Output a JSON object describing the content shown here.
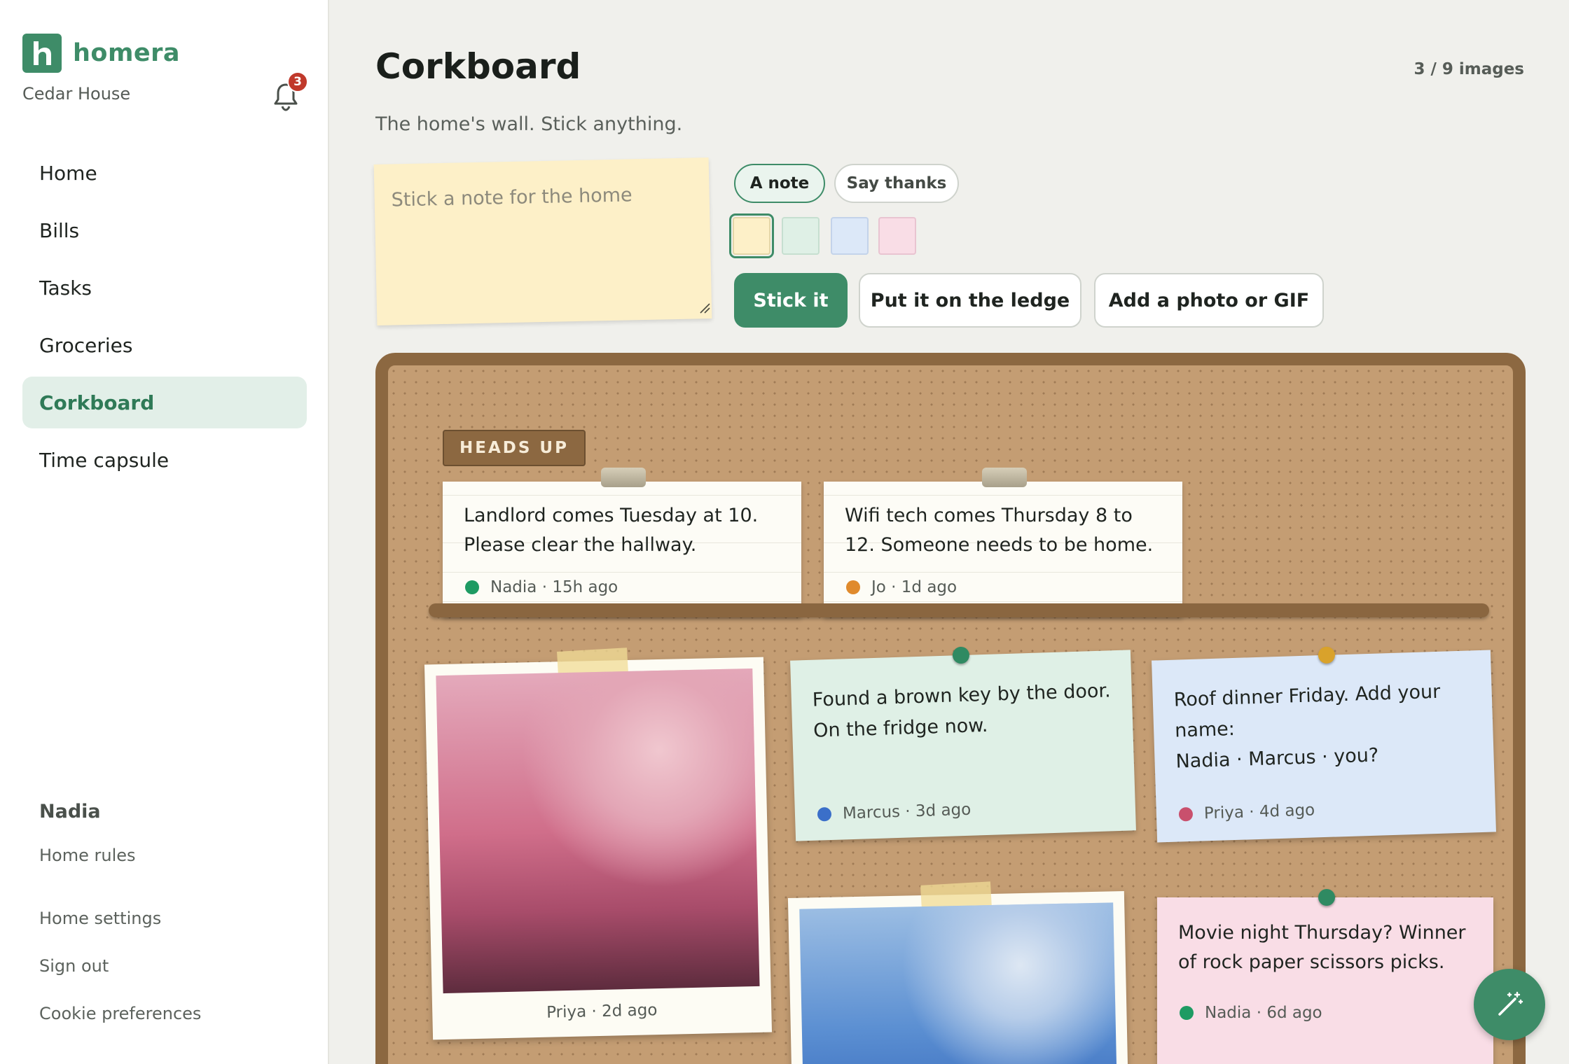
{
  "brand": {
    "name": "homera",
    "house": "Cedar House",
    "notifications": "3"
  },
  "nav": {
    "items": [
      {
        "label": "Home"
      },
      {
        "label": "Bills"
      },
      {
        "label": "Tasks"
      },
      {
        "label": "Groceries"
      },
      {
        "label": "Corkboard"
      },
      {
        "label": "Time capsule"
      }
    ],
    "active": "Corkboard"
  },
  "user": {
    "name": "Nadia",
    "links": [
      "Home rules",
      "Home settings",
      "Sign out",
      "Cookie preferences"
    ]
  },
  "page": {
    "title": "Corkboard",
    "subtitle": "The home's wall. Stick anything.",
    "image_count": "3 / 9 images"
  },
  "composer": {
    "placeholder": "Stick a note for the home",
    "kinds": [
      "A note",
      "Say thanks"
    ],
    "active_kind": "A note",
    "swatches": [
      "#fdf0c8",
      "#dff0e6",
      "#dce8f8",
      "#f9dde6"
    ],
    "selected_swatch": "#fdf0c8",
    "buttons": {
      "stick": "Stick it",
      "ledge": "Put it on the ledge",
      "media": "Add a photo or GIF"
    }
  },
  "board": {
    "headsup_label": "HEADS UP",
    "ledge": [
      {
        "text": "Landlord comes Tuesday at 10. Please clear the hallway.",
        "author": "Nadia · 15h ago",
        "dot": "#1e9b63"
      },
      {
        "text": "Wifi tech comes Thursday 8 to 12. Someone needs to be home.",
        "author": "Jo · 1d ago",
        "dot": "#e08a2c"
      }
    ],
    "notes": [
      {
        "text": "Found a brown key by the door. On the fridge now.",
        "author": "Marcus · 3d ago",
        "dot": "#3b6fc9",
        "color": "#dff0e6",
        "pin": "#2f8a62"
      },
      {
        "text": "Roof dinner Friday. Add your name:\nNadia · Marcus · you?",
        "author": "Priya · 4d ago",
        "dot": "#c9506d",
        "color": "#dce8f8",
        "pin": "#d9a22b"
      },
      {
        "text": "Movie night Thursday? Winner of rock paper scissors picks.",
        "author": "Nadia · 6d ago",
        "dot": "#1e9b63",
        "color": "#f9dde6",
        "pin": "#2f8a62"
      }
    ],
    "photos": [
      {
        "caption": "Priya · 2d ago"
      },
      {
        "caption": ""
      }
    ]
  },
  "colors": {
    "accent": "#3e8c68",
    "cork": "#c49d73",
    "frame": "#8c6841",
    "badge": "#c0392b"
  }
}
